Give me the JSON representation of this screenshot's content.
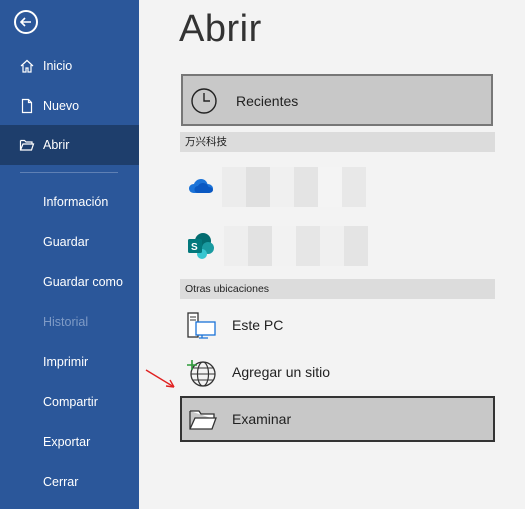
{
  "sidebar": {
    "items": [
      {
        "label": "Inicio"
      },
      {
        "label": "Nuevo"
      },
      {
        "label": "Abrir"
      },
      {
        "label": "Información"
      },
      {
        "label": "Guardar"
      },
      {
        "label": "Guardar como"
      },
      {
        "label": "Historial"
      },
      {
        "label": "Imprimir"
      },
      {
        "label": "Compartir"
      },
      {
        "label": "Exportar"
      },
      {
        "label": "Cerrar"
      }
    ],
    "bg_color": "#2b579a",
    "active_color": "#1e3e6c"
  },
  "main": {
    "title": "Abrir",
    "recent": {
      "label": "Recientes"
    },
    "sections": {
      "org": "万兴科技",
      "other": "Otras ubicaciones"
    },
    "cloud_items": [
      {
        "icon": "onedrive-icon"
      },
      {
        "icon": "sharepoint-icon"
      }
    ],
    "locations": [
      {
        "label": "Este PC",
        "icon": "this-pc-icon"
      },
      {
        "label": "Agregar un sitio",
        "icon": "add-place-icon"
      },
      {
        "label": "Examinar",
        "icon": "folder-icon"
      }
    ]
  }
}
